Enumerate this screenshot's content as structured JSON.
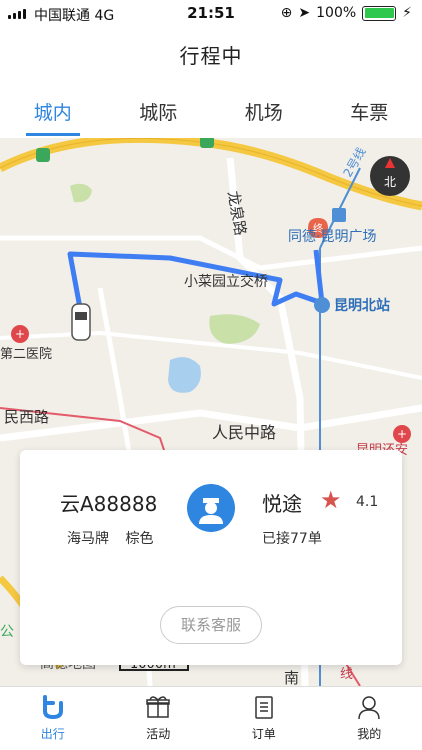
{
  "status_bar": {
    "carrier": "中国联通",
    "network": "4G",
    "time": "21:51",
    "battery": "100%"
  },
  "header": {
    "title": "行程中"
  },
  "tabs": [
    {
      "label": "城内",
      "active": true
    },
    {
      "label": "城际",
      "active": false
    },
    {
      "label": "机场",
      "active": false
    },
    {
      "label": "车票",
      "active": false
    }
  ],
  "map": {
    "labels": {
      "longquan_road": "龙泉路",
      "tongde_plaza": "同德·昆明广场",
      "xiaocaiyuan": "小菜园立交桥",
      "kunming_north": "昆明北站",
      "hospital": "第二医院",
      "minxi_road": "民西路",
      "renmin_road": "人民中路",
      "kunming_east": "昆明还安",
      "end_marker": "终",
      "compass": "北",
      "scale": "1000m",
      "logo": "高德地图",
      "park": "公",
      "south": "南",
      "line": "线",
      "line_route": "2号线"
    },
    "colors": {
      "route": "#3f7ef2",
      "road_major": "#f5c842",
      "road_minor": "#ffffff",
      "water": "#a9cfee",
      "green": "#c9e0a8"
    }
  },
  "trip_card": {
    "plate": "云A88888",
    "car_brand": "海马牌",
    "car_color": "棕色",
    "driver_name": "悦途",
    "rating": "4.1",
    "orders": "已接77单",
    "contact_button": "联系客服"
  },
  "bottom_nav": [
    {
      "label": "出行",
      "icon": "travel-icon",
      "active": true
    },
    {
      "label": "活动",
      "icon": "gift-icon",
      "active": false
    },
    {
      "label": "订单",
      "icon": "order-icon",
      "active": false
    },
    {
      "label": "我的",
      "icon": "user-icon",
      "active": false
    }
  ]
}
